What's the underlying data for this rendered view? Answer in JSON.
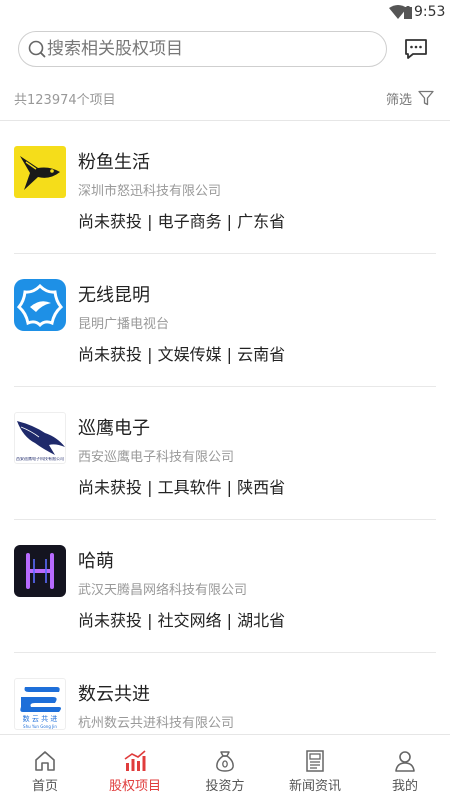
{
  "status": {
    "time": "9:53"
  },
  "search": {
    "placeholder": "搜索相关股权项目"
  },
  "summary": {
    "count_text": "共123974个项目",
    "filter_label": "筛选"
  },
  "projects": [
    {
      "name": "粉鱼生活",
      "company": "深圳市怒迅科技有限公司",
      "tags": "尚未获投 | 电子商务 | 广东省"
    },
    {
      "name": "无线昆明",
      "company": "昆明广播电视台",
      "tags": "尚未获投 | 文娱传媒 | 云南省"
    },
    {
      "name": "巡鹰电子",
      "company": "西安巡鹰电子科技有限公司",
      "tags": "尚未获投 | 工具软件 | 陕西省",
      "logo_text": "西安巡鹰电子科技有限公司"
    },
    {
      "name": "哈萌",
      "company": "武汉天腾昌网络科技有限公司",
      "tags": "尚未获投 | 社交网络 | 湖北省"
    },
    {
      "name": "数云共进",
      "company": "杭州数云共进科技有限公司",
      "tags": "",
      "logo_text": "数 云 共 进",
      "logo_subtext": "Shu Yun Gong Jin"
    }
  ],
  "nav": [
    {
      "label": "首页",
      "icon": "home-icon"
    },
    {
      "label": "股权项目",
      "icon": "chart-icon",
      "active": true
    },
    {
      "label": "投资方",
      "icon": "money-bag-icon"
    },
    {
      "label": "新闻资讯",
      "icon": "news-icon"
    },
    {
      "label": "我的",
      "icon": "user-icon"
    }
  ],
  "colors": {
    "accent": "#e03c3c",
    "divider": "#e6e6e6",
    "muted_text": "#999999"
  }
}
